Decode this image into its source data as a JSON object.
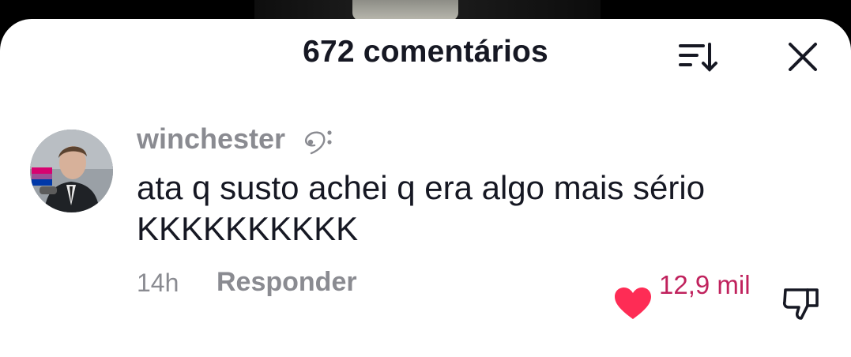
{
  "header": {
    "title": "672 comentários",
    "sort_icon": "sort-descending-icon",
    "close_icon": "close-icon"
  },
  "comment": {
    "username": "winchester",
    "username_badge_icon": "bass-clef-icon",
    "text": "ata q susto achei q era algo mais sério KKKKKKKKKK",
    "time": "14h",
    "reply_label": "Responder",
    "likes": "12,9 mil",
    "liked": true,
    "like_icon": "heart-icon",
    "dislike_icon": "thumbs-down-icon"
  },
  "colors": {
    "text_primary": "#161823",
    "text_secondary": "#8a8b91",
    "like_red": "#fe2c55",
    "like_count": "#c0225d",
    "sheet_bg": "#ffffff"
  }
}
